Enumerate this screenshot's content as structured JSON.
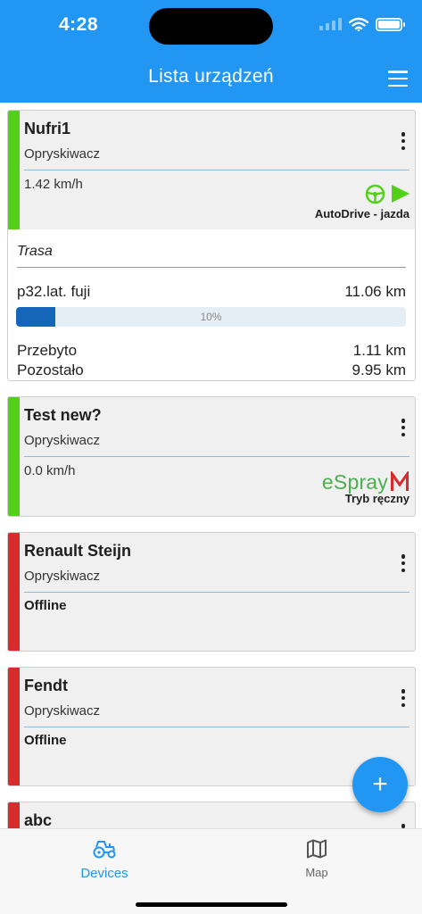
{
  "status_bar": {
    "time": "4:28"
  },
  "app_bar": {
    "title": "Lista urządzeń",
    "menu_icon": "hamburger-menu-icon"
  },
  "devices": [
    {
      "name": "Nufri1",
      "type": "Opryskiwacz",
      "speed": "1.42 km/h",
      "status_color": "#52d017",
      "mode": "AutoDrive - jazda",
      "route": {
        "title": "Trasa",
        "name": "p32.lat. fuji",
        "total": "11.06 km",
        "progress_percent": 10,
        "progress_label": "10%",
        "traveled_label": "Przebyto",
        "traveled": "1.11 km",
        "remaining_label": "Pozostało",
        "remaining": "9.95 km"
      }
    },
    {
      "name": "Test new?",
      "type": "Opryskiwacz",
      "speed": "0.0 km/h",
      "status_color": "#52d017",
      "logo_text": "eSpray",
      "mode": "Tryb ręczny"
    },
    {
      "name": "Renault Steijn",
      "type": "Opryskiwacz",
      "status_text": "Offline",
      "status_color": "#d92b2b"
    },
    {
      "name": "Fendt",
      "type": "Opryskiwacz",
      "status_text": "Offline",
      "status_color": "#d92b2b"
    },
    {
      "name": "abc",
      "status_color": "#d92b2b"
    }
  ],
  "fab": {
    "symbol": "+"
  },
  "tabs": [
    {
      "label": "Devices",
      "icon": "tractor-icon",
      "active": true
    },
    {
      "label": "Map",
      "icon": "map-icon",
      "active": false
    }
  ],
  "colors": {
    "primary": "#2196f3",
    "online": "#52d017",
    "offline": "#d92b2b",
    "progress": "#1565b8"
  }
}
